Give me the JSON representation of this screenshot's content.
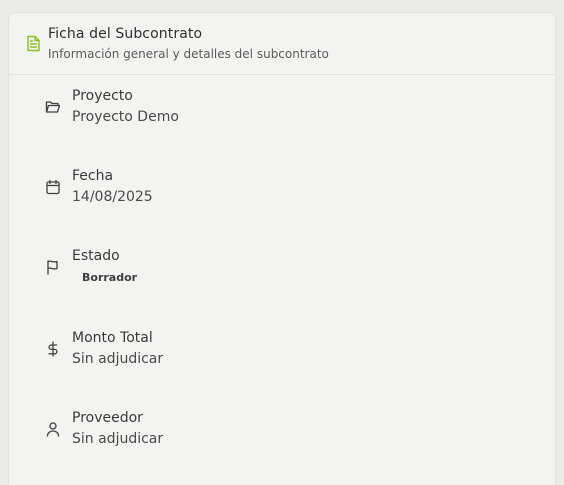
{
  "header": {
    "title": "Ficha del Subcontrato",
    "subtitle": "Información general y detalles del subcontrato",
    "icon": "document-icon",
    "icon_color": "#8cc020"
  },
  "fields": [
    {
      "icon": "folder-open-icon",
      "label": "Proyecto",
      "value": "Proyecto Demo"
    },
    {
      "icon": "calendar-icon",
      "label": "Fecha",
      "value": "14/08/2025"
    },
    {
      "icon": "flag-icon",
      "label": "Estado",
      "value": "Borrador"
    },
    {
      "icon": "dollar-icon",
      "label": "Monto Total",
      "value": "Sin adjudicar"
    },
    {
      "icon": "user-icon",
      "label": "Proveedor",
      "value": "Sin adjudicar"
    }
  ]
}
